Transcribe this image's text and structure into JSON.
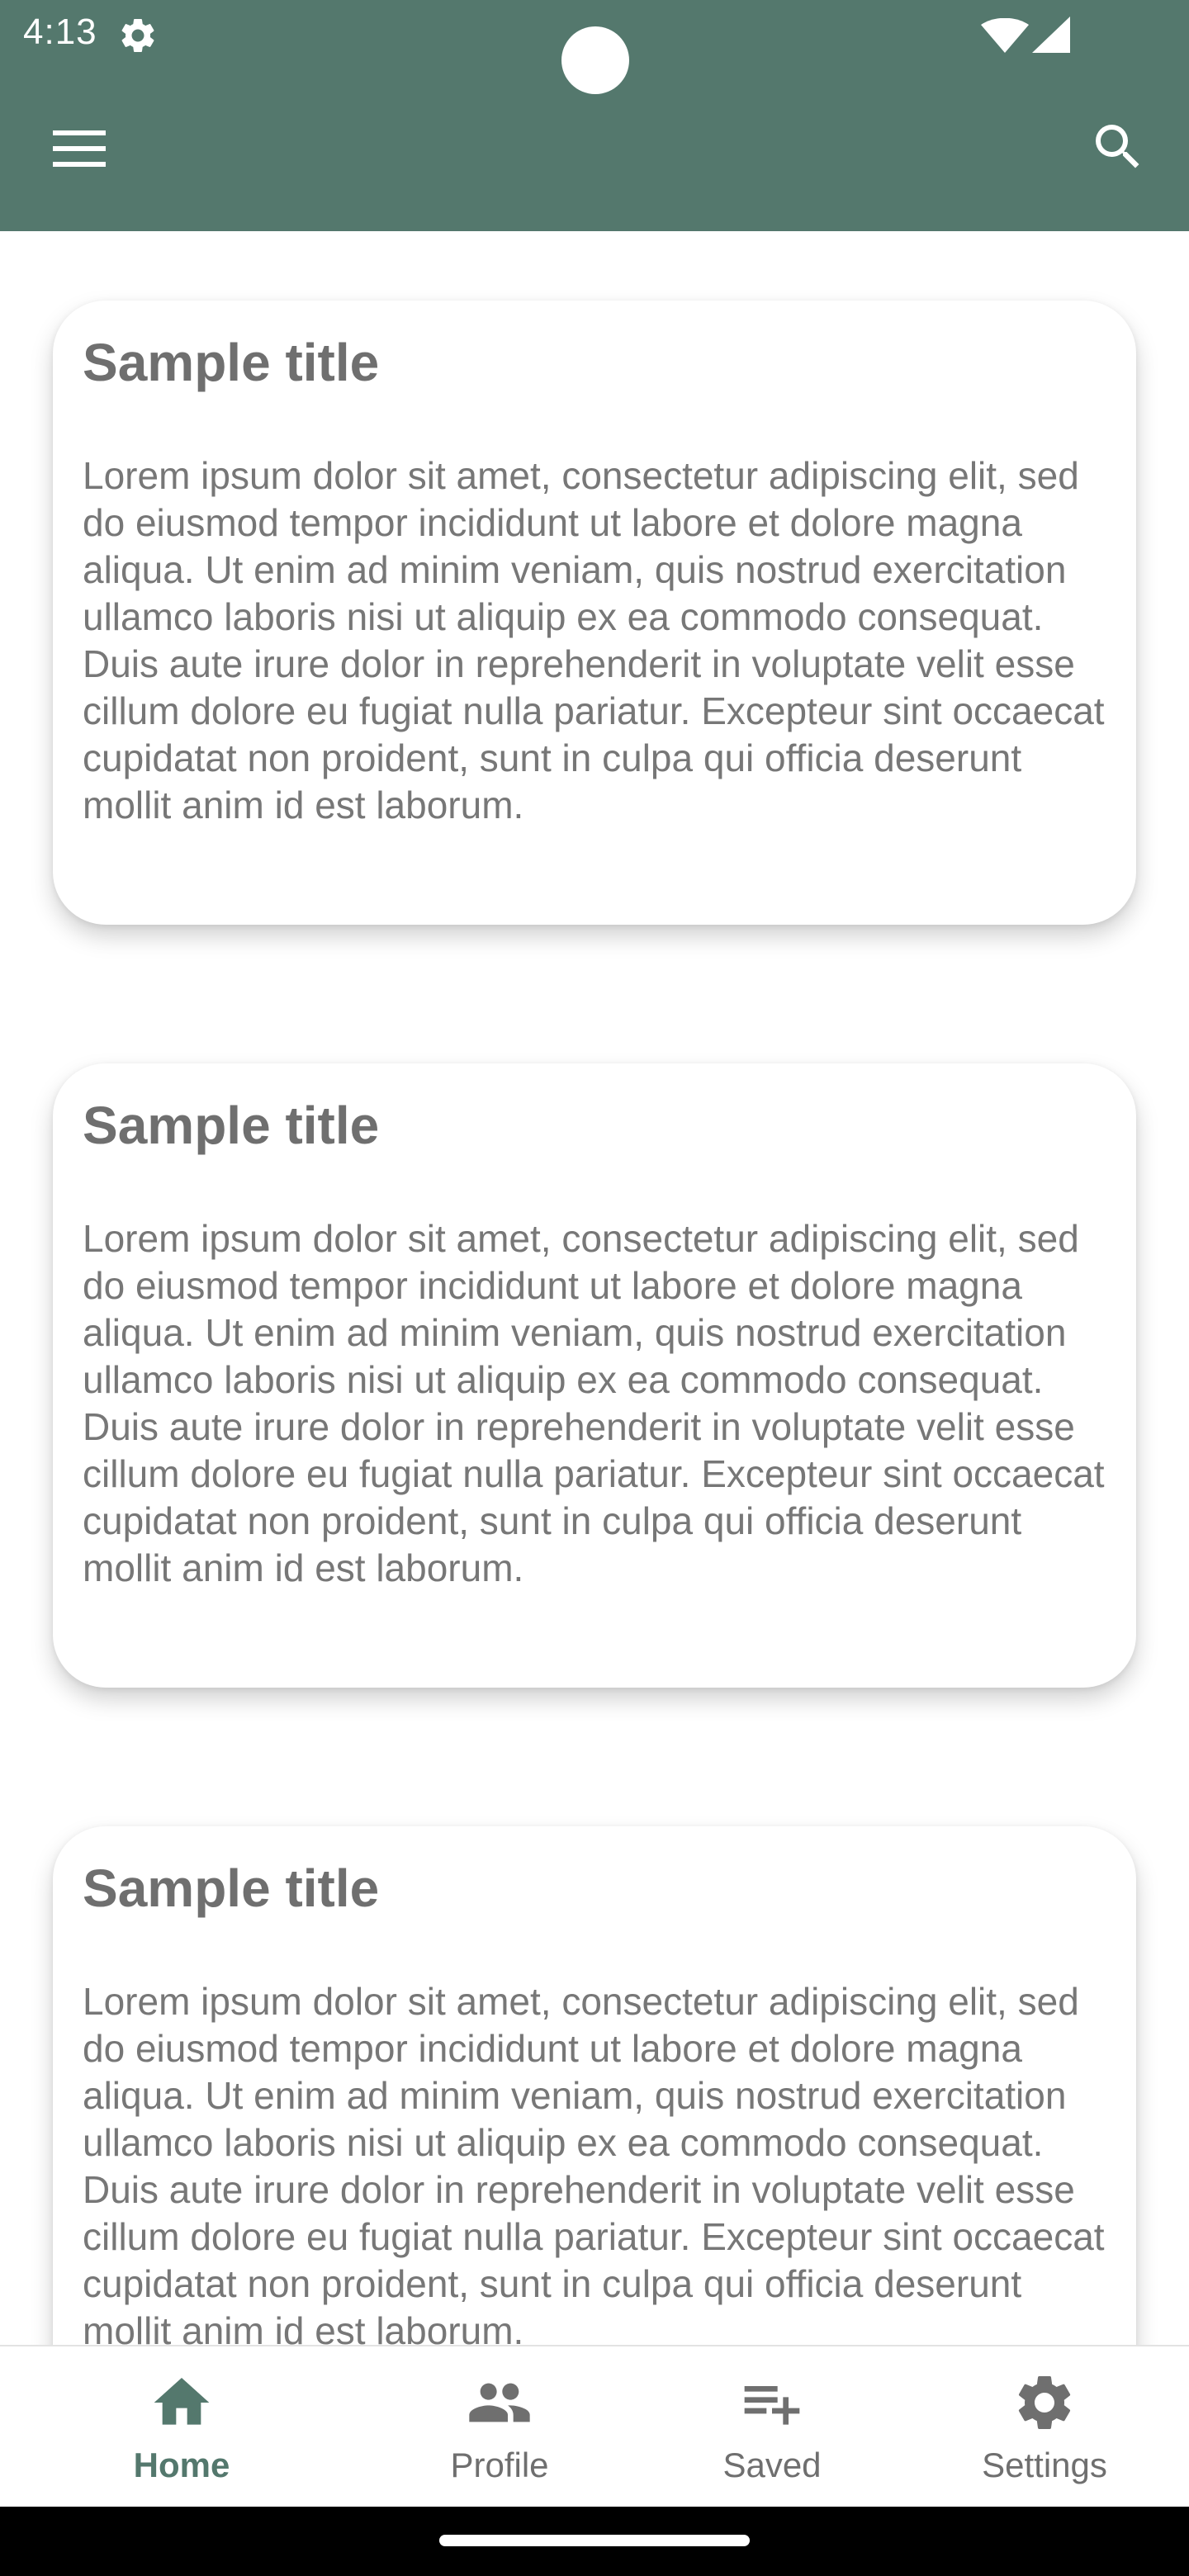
{
  "status_bar": {
    "time": "4:13"
  },
  "app_bar": {
    "menu_icon": "menu-icon",
    "search_icon": "search-icon"
  },
  "cards": [
    {
      "title": "Sample title",
      "body": "Lorem ipsum dolor sit amet, consectetur adipiscing elit, sed do eiusmod tempor incididunt ut labore et dolore magna aliqua. Ut enim ad minim veniam, quis nostrud exercitation ullamco laboris nisi ut aliquip ex ea commodo consequat. Duis aute irure dolor in reprehenderit in voluptate velit esse cillum dolore eu fugiat nulla pariatur. Excepteur sint occaecat cupidatat non proident, sunt in culpa qui officia deserunt mollit anim id est laborum."
    },
    {
      "title": "Sample title",
      "body": "Lorem ipsum dolor sit amet, consectetur adipiscing elit, sed do eiusmod tempor incididunt ut labore et dolore magna aliqua. Ut enim ad minim veniam, quis nostrud exercitation ullamco laboris nisi ut aliquip ex ea commodo consequat. Duis aute irure dolor in reprehenderit in voluptate velit esse cillum dolore eu fugiat nulla pariatur. Excepteur sint occaecat cupidatat non proident, sunt in culpa qui officia deserunt mollit anim id est laborum."
    },
    {
      "title": "Sample title",
      "body": "Lorem ipsum dolor sit amet, consectetur adipiscing elit, sed do eiusmod tempor incididunt ut labore et dolore magna aliqua. Ut enim ad minim veniam, quis nostrud exercitation ullamco laboris nisi ut aliquip ex ea commodo consequat. Duis aute irure dolor in reprehenderit in voluptate velit esse cillum dolore eu fugiat nulla pariatur. Excepteur sint occaecat cupidatat non proident, sunt in culpa qui officia deserunt mollit anim id est laborum."
    }
  ],
  "bottom_nav": {
    "items": [
      {
        "label": "Home",
        "icon": "home-icon",
        "active": true
      },
      {
        "label": "Profile",
        "icon": "people-icon",
        "active": false
      },
      {
        "label": "Saved",
        "icon": "playlist-add-icon",
        "active": false
      },
      {
        "label": "Settings",
        "icon": "gear-icon",
        "active": false
      }
    ]
  },
  "colors": {
    "primary": "#54786d",
    "title_text": "#6f6f6f",
    "body_text": "#777777",
    "inactive_nav": "#6f6f6f"
  }
}
